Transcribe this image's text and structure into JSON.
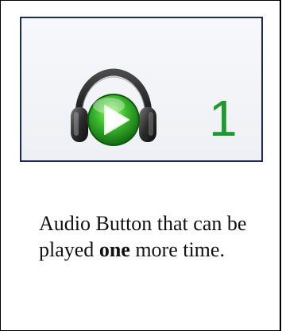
{
  "audio_control": {
    "icon": "headphones-play-icon",
    "remaining_plays": "1"
  },
  "caption": {
    "text_before": "Audio Button that can be played ",
    "emphasis": "one",
    "text_after": " more time."
  },
  "colors": {
    "panel_border": "#1f2a5c",
    "count_color": "#1c9a2b",
    "play_green": "#2fb52b"
  }
}
